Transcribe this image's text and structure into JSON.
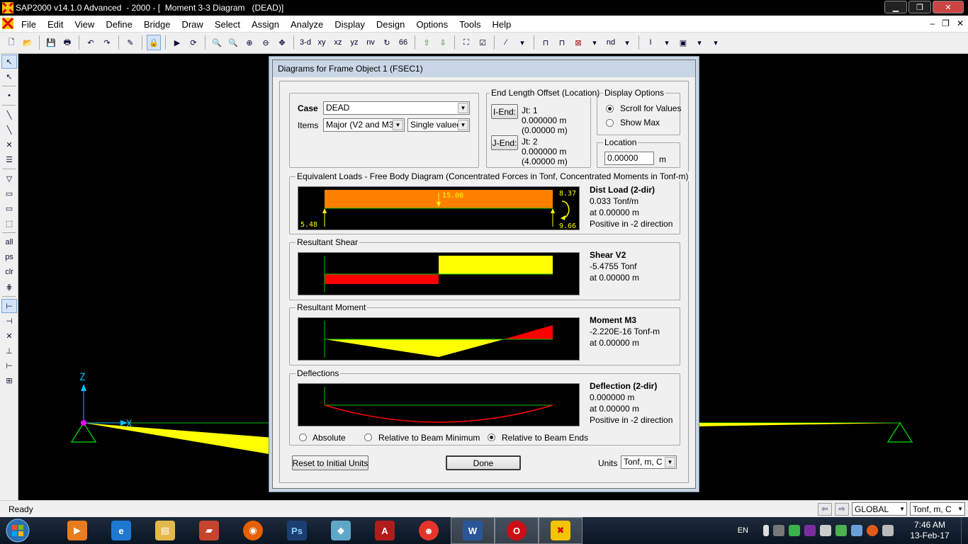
{
  "window": {
    "title": "SAP2000 v14.1.0 Advanced  - 2000 - [  Moment 3-3 Diagram   (DEAD)]",
    "controls": [
      "▁",
      "❐",
      "✕"
    ]
  },
  "menu": {
    "items": [
      "File",
      "Edit",
      "View",
      "Define",
      "Bridge",
      "Draw",
      "Select",
      "Assign",
      "Analyze",
      "Display",
      "Design",
      "Options",
      "Tools",
      "Help"
    ],
    "doc_controls": [
      "–",
      "❐",
      "✕"
    ]
  },
  "toolbar": {
    "view_labels": [
      "3-d",
      "xy",
      "xz",
      "yz",
      "nv"
    ],
    "nd_label": "nd"
  },
  "lefttools": {
    "text_labels": [
      "all",
      "ps",
      "clr"
    ]
  },
  "canvas": {
    "axis_z": "Z",
    "axis_x": "X"
  },
  "dialog": {
    "title": "Diagrams for Frame Object 1  (FSEC1)",
    "case_label": "Case",
    "case_value": "DEAD",
    "items_label": "Items",
    "items_value": "Major (V2 and M3)",
    "valued_value": "Single valued",
    "end_offset": {
      "label": "End Length Offset (Location)",
      "i_end_button": "I-End:",
      "i_jt": "Jt:  1",
      "i_val1": "0.000000 m",
      "i_val2": "(0.00000 m)",
      "j_end_button": "J-End:",
      "j_jt": "Jt:  2",
      "j_val1": "0.000000 m",
      "j_val2": "(4.00000 m)"
    },
    "display_options": {
      "label": "Display Options",
      "scroll": "Scroll for Values",
      "show_max": "Show Max",
      "selected": "scroll"
    },
    "location": {
      "label": "Location",
      "value": "0.00000",
      "unit": "m"
    },
    "fbd": {
      "label": "Equivalent Loads - Free Body Diagram  (Concentrated Forces in Tonf, Concentrated Moments in Tonf-m)",
      "load_value": "15.00",
      "left_reaction": "5.48",
      "right_moment": "8.37",
      "right_reaction": "9.66",
      "info_title": "Dist Load (2-dir)",
      "info_line1": "0.033 Tonf/m",
      "info_line2": "at 0.00000 m",
      "info_line3": "Positive in -2 direction"
    },
    "shear": {
      "label": "Resultant Shear",
      "info_title": "Shear V2",
      "info_line1": "-5.4755 Tonf",
      "info_line2": "at 0.00000 m"
    },
    "moment": {
      "label": "Resultant Moment",
      "info_title": "Moment M3",
      "info_line1": "-2.220E-16 Tonf-m",
      "info_line2": "at 0.00000 m"
    },
    "deflection": {
      "label": "Deflections",
      "info_title": "Deflection (2-dir)",
      "info_line1": "0.000000 m",
      "info_line2": "at 0.00000 m",
      "info_line3": "Positive in -2 direction",
      "opt_absolute": "Absolute",
      "opt_rel_min": "Relative to Beam Minimum",
      "opt_rel_ends": "Relative to Beam Ends",
      "selected": "rel_ends"
    },
    "reset_button": "Reset to Initial Units",
    "done_button": "Done",
    "units_label": "Units",
    "units_value": "Tonf, m, C"
  },
  "statusbar": {
    "ready": "Ready",
    "coord_system": "GLOBAL",
    "units": "Tonf, m, C"
  },
  "taskbar": {
    "language": "EN",
    "time": "7:46 AM",
    "date": "13-Feb-17"
  },
  "colors": {
    "orange_load": "#ff8000",
    "yellow": "#ffff00",
    "red": "#ff0000",
    "green": "#00c000",
    "cyan_axis": "#00c0ff",
    "magenta_joint": "#ff00ff"
  }
}
